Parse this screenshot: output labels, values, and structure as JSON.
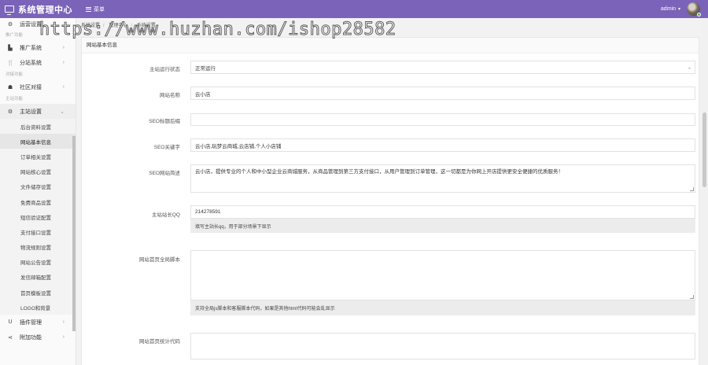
{
  "app": {
    "title": "系统管理中心",
    "menu_label": "菜单"
  },
  "user": {
    "name": "admin"
  },
  "breadcrumb": [
    "系统设置",
    "管理中心",
    "系统设置"
  ],
  "sidebar": {
    "top_item": "运营设置",
    "section1": "推广功能",
    "promo": "推广系统",
    "sub_site": "分站系统",
    "section2": "对接功能",
    "dock": "社区对接",
    "section3": "主站功能",
    "main": "主站设置",
    "subitems": [
      "后台资料设置",
      "网站基本信息",
      "订单相关设置",
      "网站核心设置",
      "文件储存设置",
      "免费商品设置",
      "短信验证配置",
      "支付接口设置",
      "物流规则设置",
      "网站公告设置",
      "发信邮箱配置",
      "首页模板设置",
      "LOGO和背景"
    ],
    "plugins": "插件管理",
    "extras": "附加功能"
  },
  "panel": {
    "title": "网站基本信息",
    "status_label": "主站运行状态",
    "status_value": "正常运行",
    "name_label": "网站名称",
    "name_value": "云小店",
    "seo_title_label": "SEO标题后缀",
    "seo_title_value": "",
    "seo_kw_label": "SEO关键字",
    "seo_kw_value": "云小店,玩梦云商城,云店铺,个人小店铺",
    "seo_desc_label": "SEO网站简述",
    "seo_desc_value": "云小店，提供专业的个人和中小型企业云商城服务，从商品管理到第三方支付接口，从用户管理到订单管理，这一切都是为你网上开店提供更安全便捷的优质服务！",
    "qq_label": "主站站长QQ",
    "qq_value": "214278591",
    "qq_help": "填写主站长qq，用于部分场景下显示",
    "script_label": "网站首页全局脚本",
    "script_help": "支持全局js脚本和客服脚本代码，如果是其他html代码可能会乱显示",
    "stats_label": "网站首页统计代码"
  },
  "watermark": "https://www.huzhan.com/ishop28582"
}
